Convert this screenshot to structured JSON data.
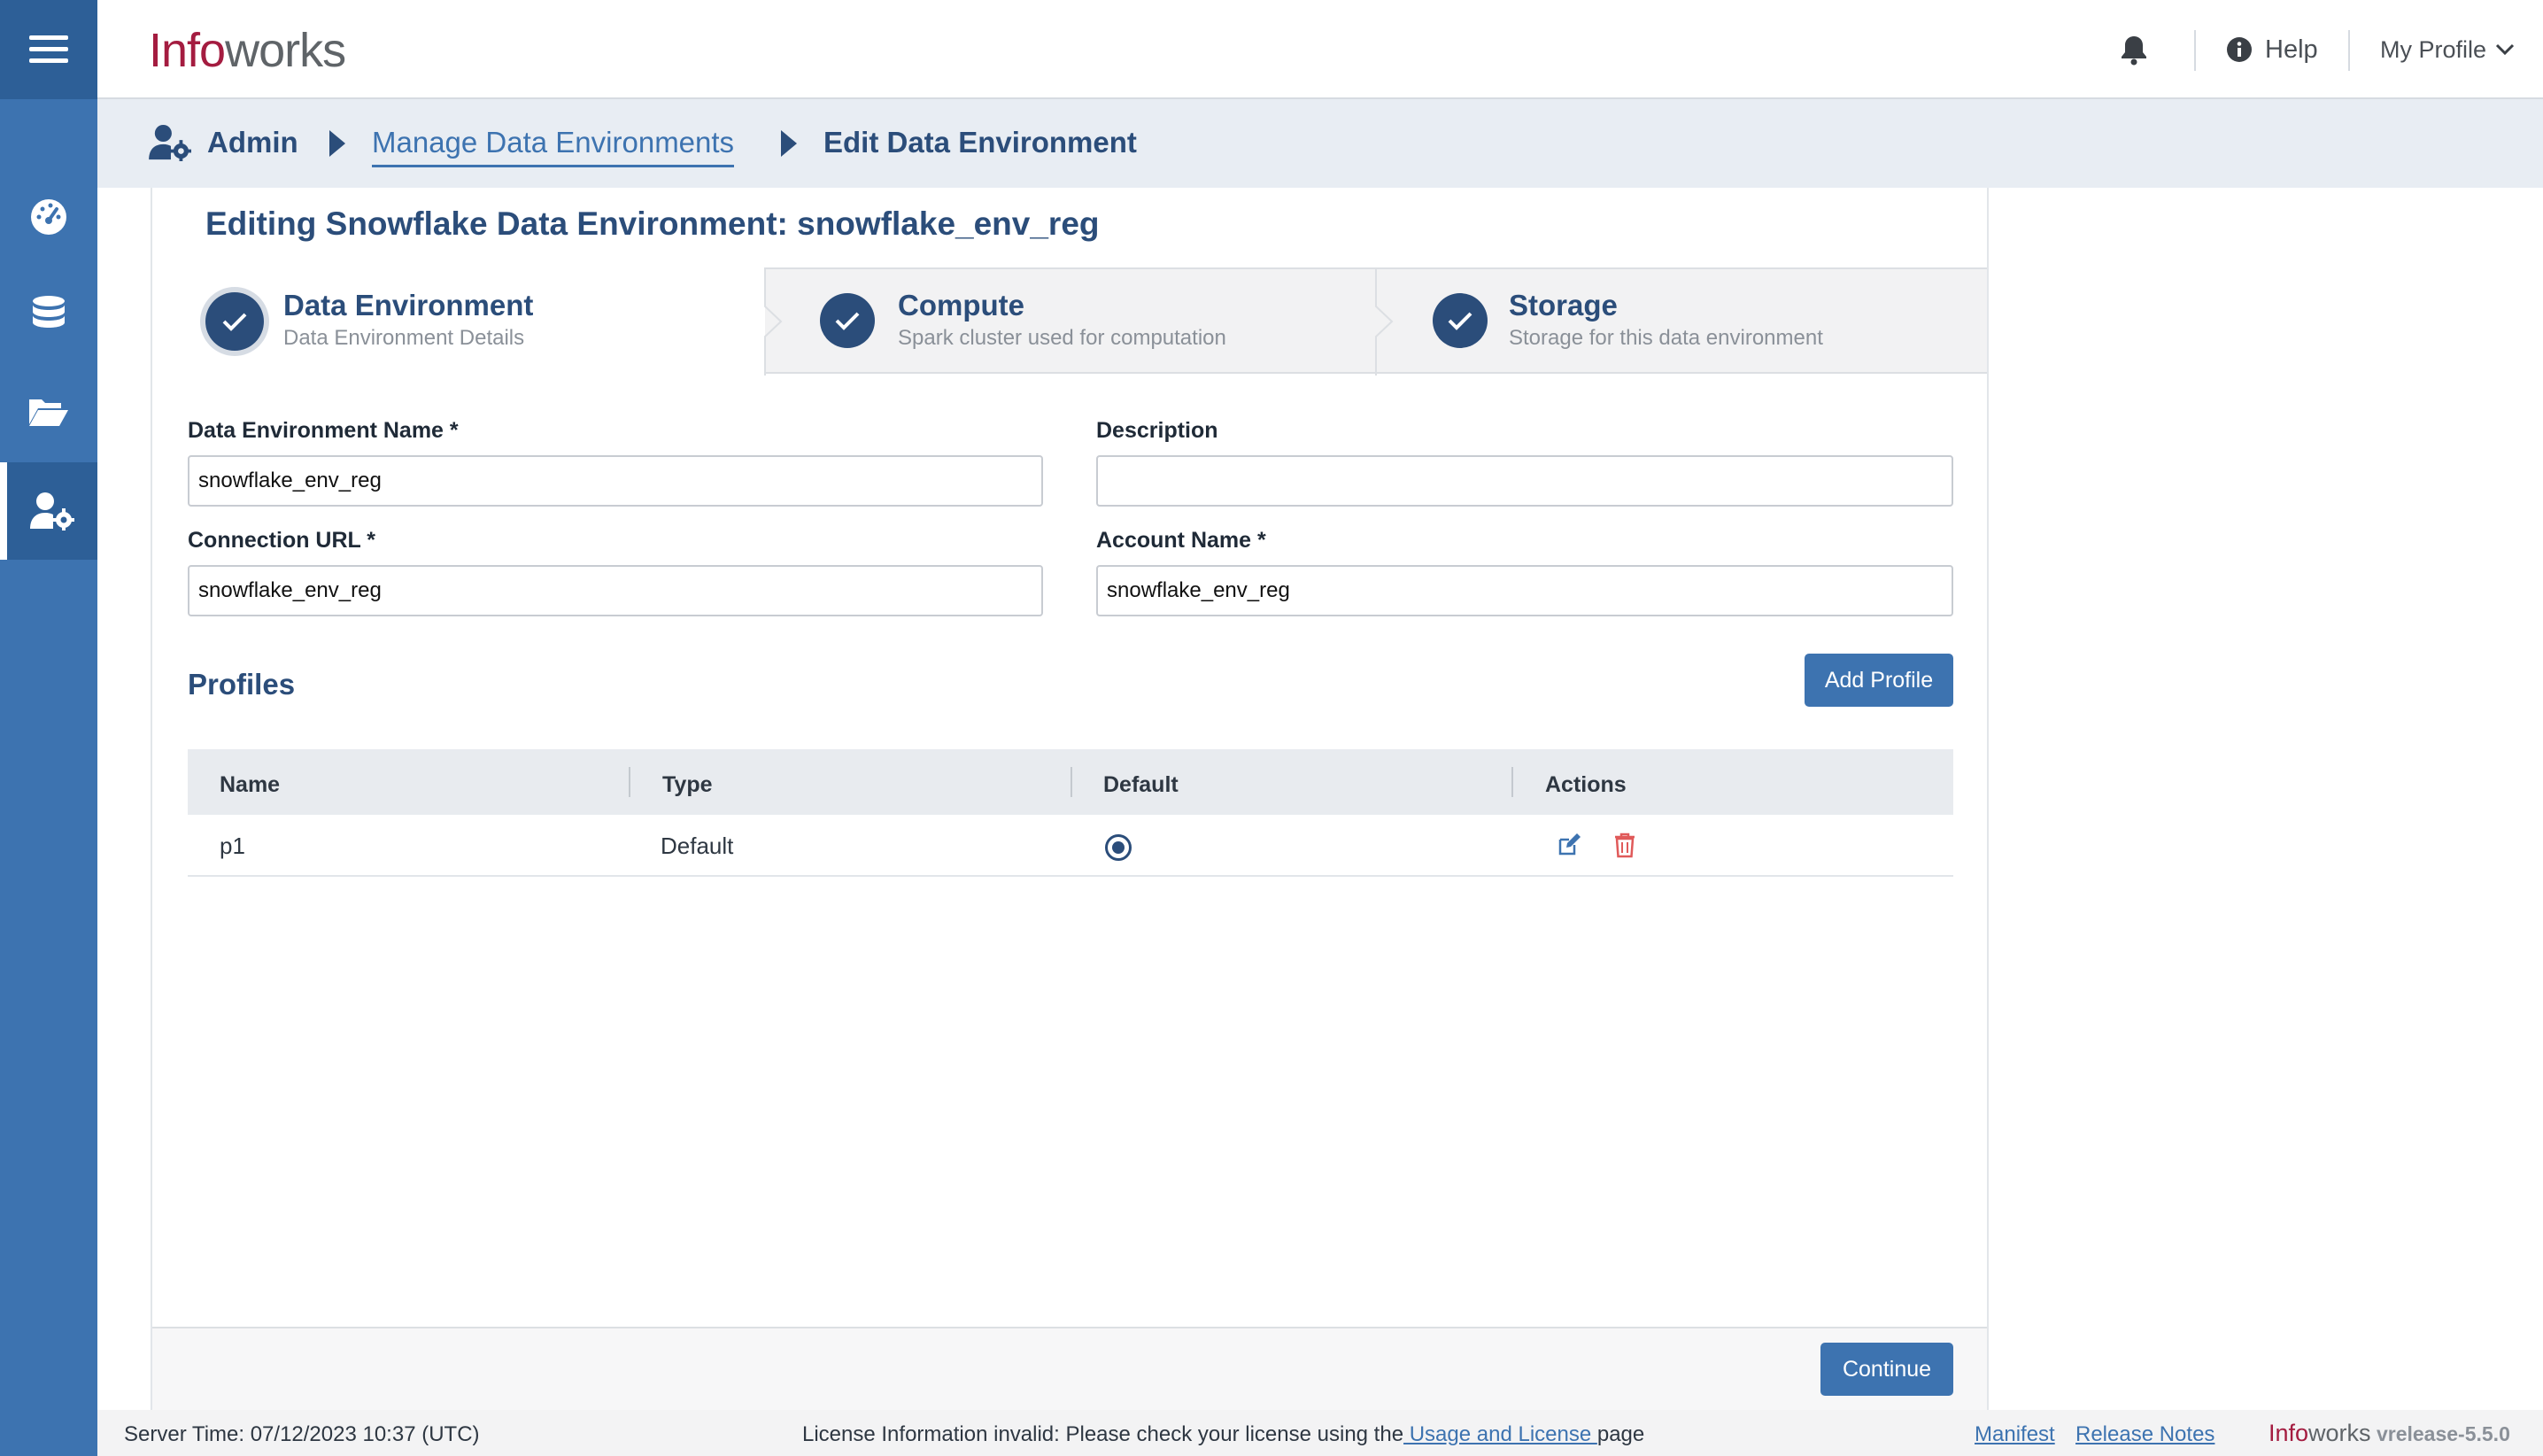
{
  "app": {
    "logo_part1": "Info",
    "logo_part2": "works"
  },
  "header": {
    "help_label": "Help",
    "profile_label": "My Profile"
  },
  "sidebar": {
    "items": [
      "menu-icon",
      "dashboard-icon",
      "database-icon",
      "folder-open-icon",
      "admin-user-gear-icon"
    ],
    "active": "admin-user-gear-icon"
  },
  "breadcrumb": {
    "admin": "Admin",
    "manage": "Manage Data Environments",
    "current": "Edit Data Environment"
  },
  "page": {
    "title": "Editing Snowflake Data Environment: snowflake_env_reg"
  },
  "steps": [
    {
      "title": "Data Environment",
      "subtitle": "Data Environment Details",
      "state": "active"
    },
    {
      "title": "Compute",
      "subtitle": "Spark cluster used for computation",
      "state": "done"
    },
    {
      "title": "Storage",
      "subtitle": "Storage for this data environment",
      "state": "done"
    }
  ],
  "form": {
    "env_name": {
      "label": "Data Environment Name *",
      "value": "snowflake_env_reg"
    },
    "description": {
      "label": "Description",
      "value": ""
    },
    "connection_url": {
      "label": "Connection URL *",
      "value": "snowflake_env_reg"
    },
    "account_name": {
      "label": "Account Name *",
      "value": "snowflake_env_reg"
    }
  },
  "profiles": {
    "heading": "Profiles",
    "add_label": "Add Profile",
    "columns": [
      "Name",
      "Type",
      "Default",
      "Actions"
    ],
    "rows": [
      {
        "name": "p1",
        "type": "Default",
        "is_default": true
      }
    ]
  },
  "actions": {
    "continue_label": "Continue"
  },
  "footer": {
    "server_time": "Server Time: 07/12/2023 10:37 (UTC)",
    "license_prefix": "License Information invalid: Please check your license using the",
    "license_link": " Usage and License ",
    "license_suffix": "page",
    "manifest": "Manifest",
    "release_notes": "Release Notes",
    "brand_part1": "Info",
    "brand_part2": "works",
    "version": "vrelease-5.5.0"
  },
  "colors": {
    "primary": "#3d73b0",
    "navy": "#2b4d7a",
    "brand_red": "#a41c40",
    "danger": "#e05a5a"
  }
}
